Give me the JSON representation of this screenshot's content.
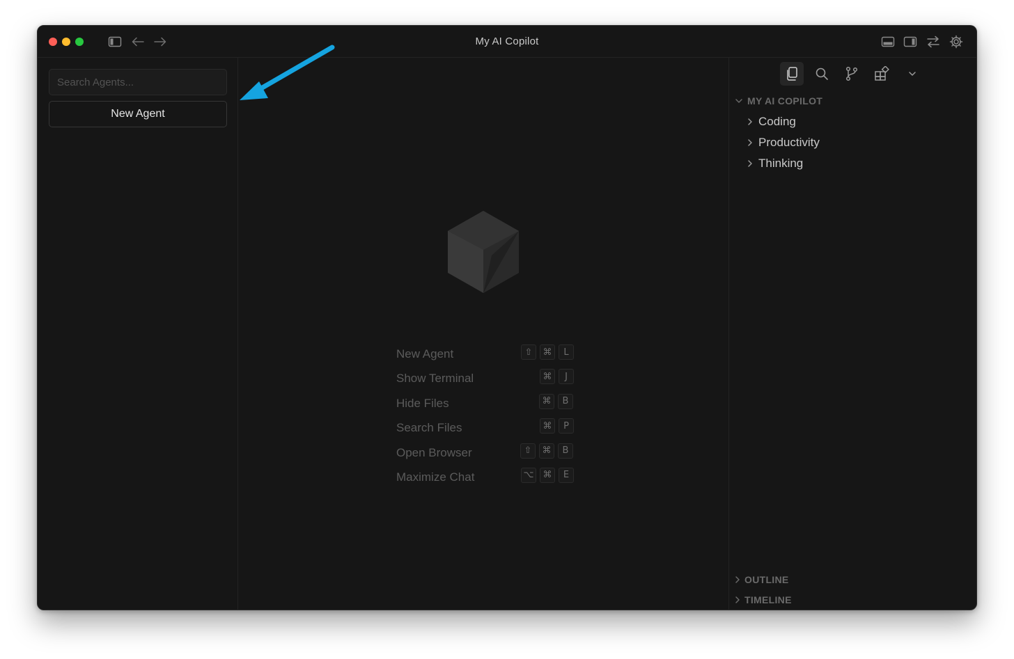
{
  "window": {
    "title": "My AI Copilot"
  },
  "sidebar": {
    "search_placeholder": "Search Agents...",
    "new_agent_label": "New Agent"
  },
  "main": {
    "shortcuts": [
      {
        "label": "New Agent",
        "keys": [
          "⇧",
          "⌘",
          "L"
        ]
      },
      {
        "label": "Show Terminal",
        "keys": [
          "⌘",
          "J"
        ]
      },
      {
        "label": "Hide Files",
        "keys": [
          "⌘",
          "B"
        ]
      },
      {
        "label": "Search Files",
        "keys": [
          "⌘",
          "P"
        ]
      },
      {
        "label": "Open Browser",
        "keys": [
          "⇧",
          "⌘",
          "B"
        ]
      },
      {
        "label": "Maximize Chat",
        "keys": [
          "⌥",
          "⌘",
          "E"
        ]
      }
    ]
  },
  "explorer": {
    "root": "MY AI COPILOT",
    "folders": [
      "Coding",
      "Productivity",
      "Thinking"
    ],
    "sections": [
      "OUTLINE",
      "TIMELINE"
    ]
  },
  "colors": {
    "annotation_arrow": "#15a4e0",
    "traffic_red": "#fe5f57",
    "traffic_yellow": "#febc2e",
    "traffic_green": "#28c840"
  }
}
